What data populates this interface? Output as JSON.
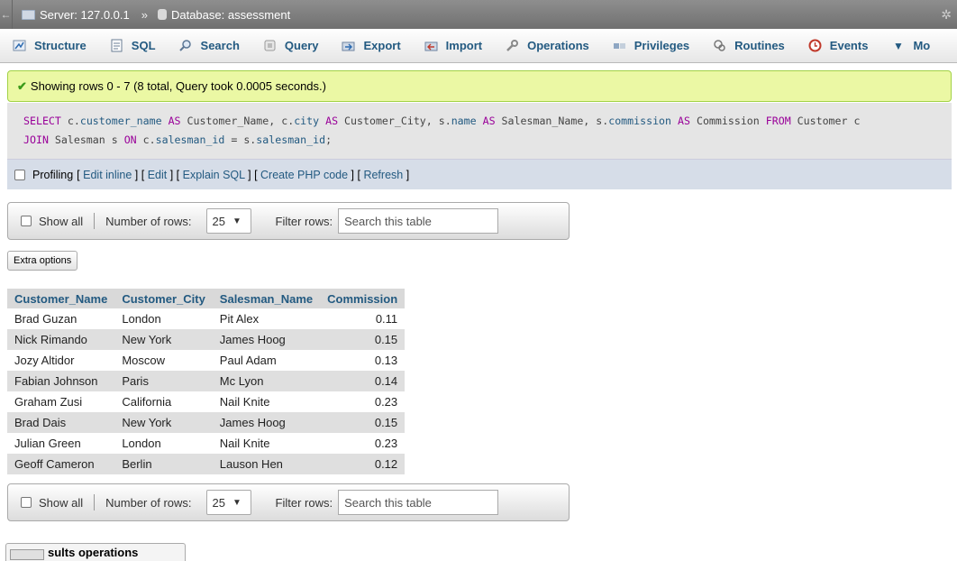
{
  "breadcrumb": {
    "back_glyph": "←",
    "server": "Server: 127.0.0.1",
    "separator": "»",
    "database": "Database: assessment"
  },
  "tabs": [
    {
      "label": "Structure",
      "icon": "structure-icon"
    },
    {
      "label": "SQL",
      "icon": "sql-icon"
    },
    {
      "label": "Search",
      "icon": "search-icon"
    },
    {
      "label": "Query",
      "icon": "query-icon"
    },
    {
      "label": "Export",
      "icon": "export-icon"
    },
    {
      "label": "Import",
      "icon": "import-icon"
    },
    {
      "label": "Operations",
      "icon": "wrench-icon"
    },
    {
      "label": "Privileges",
      "icon": "privileges-icon"
    },
    {
      "label": "Routines",
      "icon": "routines-icon"
    },
    {
      "label": "Events",
      "icon": "clock-icon"
    },
    {
      "label": "Mo",
      "icon": "more-caret-icon"
    }
  ],
  "success_message": "Showing rows 0 - 7 (8 total, Query took 0.0005 seconds.)",
  "sql_query": {
    "line1": "SELECT c.customer_name AS Customer_Name, c.city AS Customer_City, s.name AS Salesman_Name, s.commission AS Commission FROM Customer c",
    "line2": "JOIN Salesman s ON c.salesman_id = s.salesman_id;"
  },
  "profiling": {
    "label": "Profiling",
    "links": [
      "Edit inline",
      "Edit",
      "Explain SQL",
      "Create PHP code",
      "Refresh"
    ]
  },
  "navigation": {
    "show_all": "Show all",
    "number_of_rows_label": "Number of rows:",
    "number_of_rows_value": "25",
    "filter_label": "Filter rows:",
    "filter_placeholder": "Search this table"
  },
  "extra_options": "Extra options",
  "results": {
    "columns": [
      "Customer_Name",
      "Customer_City",
      "Salesman_Name",
      "Commission"
    ],
    "rows": [
      [
        "Brad Guzan",
        "London",
        "Pit Alex",
        "0.11"
      ],
      [
        "Nick Rimando",
        "New York",
        "James Hoog",
        "0.15"
      ],
      [
        "Jozy Altidor",
        "Moscow",
        "Paul Adam",
        "0.13"
      ],
      [
        "Fabian Johnson",
        "Paris",
        "Mc Lyon",
        "0.14"
      ],
      [
        "Graham Zusi",
        "California",
        "Nail Knite",
        "0.23"
      ],
      [
        "Brad Dais",
        "New York",
        "James Hoog",
        "0.15"
      ],
      [
        "Julian Green",
        "London",
        "Nail Knite",
        "0.23"
      ],
      [
        "Geoff Cameron",
        "Berlin",
        "Lauson Hen",
        "0.12"
      ]
    ]
  },
  "results_operations_tab": "sults operations",
  "colors": {
    "link": "#235a81",
    "success_bg": "#ebf8a4",
    "keyword": "#990099"
  }
}
